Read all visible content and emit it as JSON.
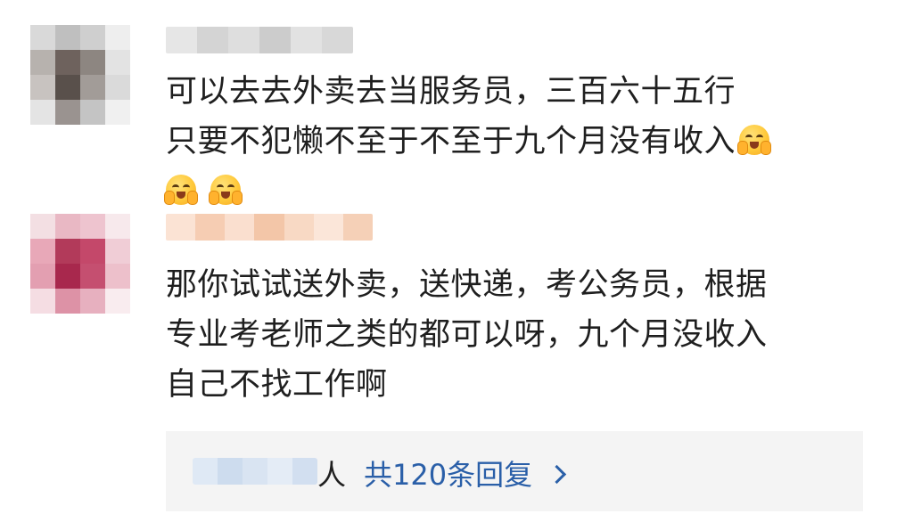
{
  "comments": [
    {
      "lines": [
        "可以去去外卖去当服务员，三百六十五行",
        "只要不犯懒不至于不至于九个月没有收入"
      ],
      "emojis": [
        "shy-smile-emoji",
        "shy-smile-emoji",
        "shy-smile-emoji"
      ]
    },
    {
      "lines": [
        "那你试试送外卖，送快递，考公务员，根据",
        "专业考老师之类的都可以呀，九个月没收入",
        "自己不找工作啊"
      ]
    }
  ],
  "replies": {
    "person_suffix": "人",
    "link_label": "共120条回复"
  },
  "colors": {
    "text": "#1f1f1f",
    "link": "#2a5fa8",
    "reply_bar_bg": "#f4f4f4"
  }
}
